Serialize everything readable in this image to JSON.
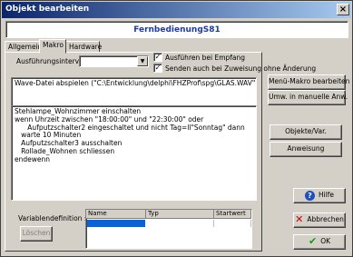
{
  "window": {
    "title": "Objekt bearbeiten",
    "close_glyph": "×"
  },
  "header": {
    "object_name": "FernbedienungS81"
  },
  "tabs": [
    {
      "label": "Allgemein"
    },
    {
      "label": "Makro"
    },
    {
      "label": "Hardware"
    }
  ],
  "makro": {
    "interval_label": "Ausführungsintervall :",
    "interval_value": "",
    "checkbox_run_on_receive": {
      "label": "Ausführen bei Empfang",
      "checked": true
    },
    "checkbox_send_on_assign": {
      "label": "Senden auch bei Zuweisung ohne Änderung",
      "checked": true
    },
    "menu_macro_text": "Wave-Datei abspielen (\"C:\\Entwicklung\\delphi\\FHZProf\\spg\\GLAS.WAV\")",
    "script_text": "Stehlampe_Wohnzimmer einschalten\nwenn Uhrzeit zwischen \"18:00:00\" und \"22:30:00\" oder\n      Aufputzschalter2 eingeschaltet und nicht Tag=ll\"Sonntag\" dann\n   warte 10 Minuten\n   Aufputzschalter3 ausschalten\n   Rollade_Wohnen schliessen\nendewenn",
    "variables_label": "Variablendefinition :",
    "delete_button": "Löschen",
    "grid_headers": [
      "Name",
      "Typ",
      "Startwert"
    ]
  },
  "buttons": {
    "edit_menu_macro": "Menü-Makro bearbeiten",
    "convert_manual": "Umw. in manuelle Anw.",
    "objects_vars": "Objekte/Var.",
    "instruction": "Anweisung",
    "help": "Hilfe",
    "cancel": "Abbrechen",
    "ok": "OK"
  },
  "colors": {
    "title_start": "#0a246a",
    "title_end": "#a6caf0",
    "header_text": "#1c3aa8",
    "grid_selection": "#0a64d8"
  }
}
